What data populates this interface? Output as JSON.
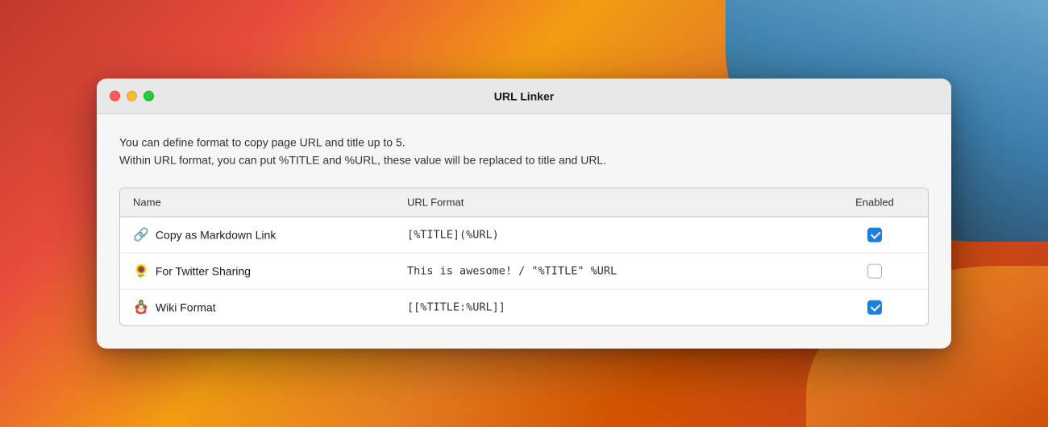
{
  "background": {
    "gradient": "macOS Big Sur wallpaper"
  },
  "window": {
    "title": "URL Linker",
    "traffic_lights": {
      "close_label": "close",
      "minimize_label": "minimize",
      "maximize_label": "maximize"
    }
  },
  "description": {
    "line1": "You can define format to copy page URL and title up to 5.",
    "line2": "Within URL format, you can put %TITLE and %URL, these value will be replaced to title and URL."
  },
  "table": {
    "headers": {
      "name": "Name",
      "url_format": "URL Format",
      "enabled": "Enabled"
    },
    "rows": [
      {
        "icon": "🔗",
        "name": "Copy as Markdown Link",
        "url_format": "[%TITLE](%URL)",
        "enabled": true
      },
      {
        "icon": "🌻",
        "name": "For Twitter Sharing",
        "url_format": "This is awesome! / \"%TITLE\" %URL",
        "enabled": false
      },
      {
        "icon": "🪆",
        "name": "Wiki Format",
        "url_format": "[[%TITLE:%URL]]",
        "enabled": true
      }
    ]
  }
}
